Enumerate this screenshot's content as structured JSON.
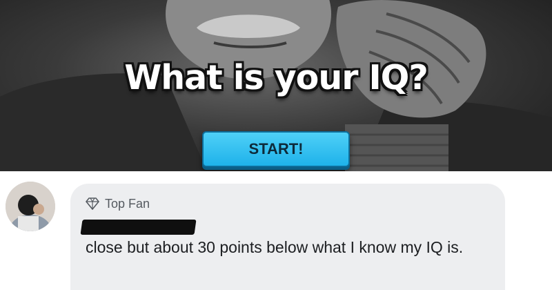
{
  "hero": {
    "title": "What is your IQ?",
    "start_label": "START!"
  },
  "comment": {
    "badge_label": "Top Fan",
    "badge_icon": "diamond-icon",
    "text": "close but about 30 points below what I know my IQ is."
  },
  "colors": {
    "start_button": "#1fb2ea",
    "bubble": "#edeef0",
    "text": "#1c1e21",
    "badge_text": "#555a60"
  }
}
